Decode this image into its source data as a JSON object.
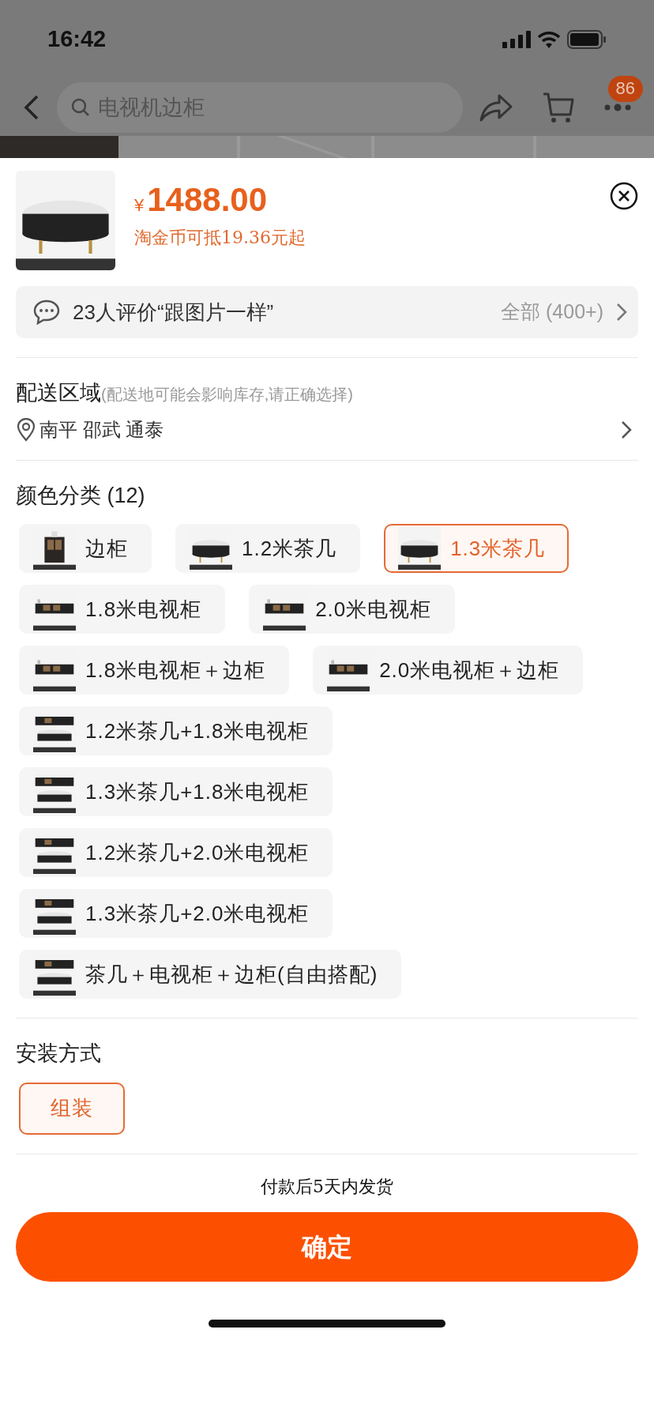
{
  "status_bar": {
    "time": "16:42"
  },
  "nav": {
    "search_placeholder": "电视机边柜",
    "badge": "86"
  },
  "product": {
    "currency": "¥",
    "price": "1488.00",
    "coin_note": "淘金币可抵19.36元起"
  },
  "reviews": {
    "summary": "23人评价“跟图片一样”",
    "all": "全部 (400+)"
  },
  "delivery": {
    "title": "配送区域",
    "hint": "(配送地可能会影响库存,请正确选择)",
    "location": "南平 邵武 通泰"
  },
  "options": [
    {
      "title": "颜色分类 (12)",
      "items": [
        {
          "label": "边柜",
          "selected": false,
          "thumb": true
        },
        {
          "label": "1.2米茶几",
          "selected": false,
          "thumb": true
        },
        {
          "label": "1.3米茶几",
          "selected": true,
          "thumb": true
        },
        {
          "label": "1.8米电视柜",
          "selected": false,
          "thumb": true
        },
        {
          "label": "2.0米电视柜",
          "selected": false,
          "thumb": true
        },
        {
          "label": "1.8米电视柜＋边柜",
          "selected": false,
          "thumb": true
        },
        {
          "label": "2.0米电视柜＋边柜",
          "selected": false,
          "thumb": true
        },
        {
          "label": "1.2米茶几+1.8米电视柜",
          "selected": false,
          "thumb": true
        },
        {
          "label": "1.3米茶几+1.8米电视柜",
          "selected": false,
          "thumb": true
        },
        {
          "label": "1.2米茶几+2.0米电视柜",
          "selected": false,
          "thumb": true
        },
        {
          "label": "1.3米茶几+2.0米电视柜",
          "selected": false,
          "thumb": true
        },
        {
          "label": "茶几＋电视柜＋边柜(自由搭配)",
          "selected": false,
          "thumb": true
        }
      ]
    },
    {
      "title": "安装方式",
      "items": [
        {
          "label": "组装",
          "selected": true,
          "thumb": false
        }
      ]
    }
  ],
  "shipping_note": "付款后5天内发货",
  "confirm": "确定"
}
